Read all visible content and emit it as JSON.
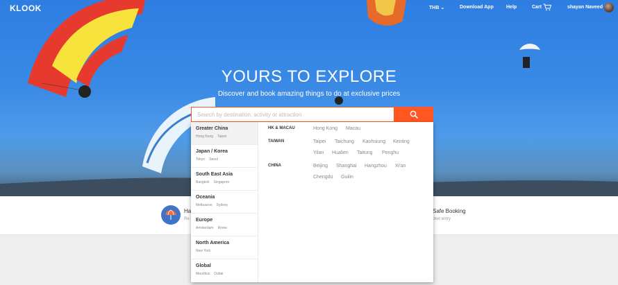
{
  "header": {
    "logo": "KLOOK",
    "currency": "THB",
    "download": "Download App",
    "help": "Help",
    "cart": "Cart",
    "user": "shayan Naveed"
  },
  "hero": {
    "headline": "YOURS TO EXPLORE",
    "subheadline": "Discover and book amazing things to do at exclusive prices"
  },
  "search": {
    "placeholder": "Search by destination, activity or attraction"
  },
  "regions": [
    {
      "name": "Greater China",
      "cities": [
        "Hong Kong",
        "Taipei"
      ]
    },
    {
      "name": "Japan / Korea",
      "cities": [
        "Tokyo",
        "Seoul"
      ]
    },
    {
      "name": "South East Asia",
      "cities": [
        "Bangkok",
        "Singapore"
      ]
    },
    {
      "name": "Oceania",
      "cities": [
        "Melbourne",
        "Sydney"
      ]
    },
    {
      "name": "Europe",
      "cities": [
        "Amsterdam",
        "Rome"
      ]
    },
    {
      "name": "North America",
      "cities": [
        "New York"
      ]
    },
    {
      "name": "Global",
      "cities": [
        "Mauritius",
        "Dubai"
      ]
    }
  ],
  "countries": {
    "hk_macau": {
      "label": "HK & MACAU",
      "cities": [
        "Hong Kong",
        "Macau"
      ]
    },
    "taiwan": {
      "label": "TAIWAN",
      "cities": [
        "Taipei",
        "Taichung",
        "Kaohsiung",
        "Kenting",
        "Yilan",
        "Hualien",
        "Taitung",
        "Penghu"
      ]
    },
    "china": {
      "label": "CHINA",
      "cities": [
        "Beijing",
        "Shanghai",
        "Hangzhou",
        "Xi'an",
        "Chengdu",
        "Guilin"
      ]
    }
  },
  "features": {
    "left_title": "Ha",
    "left_sub": "Re",
    "right_title": "Safe Booking",
    "right_sub": "cket entry"
  },
  "colors": {
    "accent": "#ff5722",
    "sky": "#3a8ae6"
  }
}
